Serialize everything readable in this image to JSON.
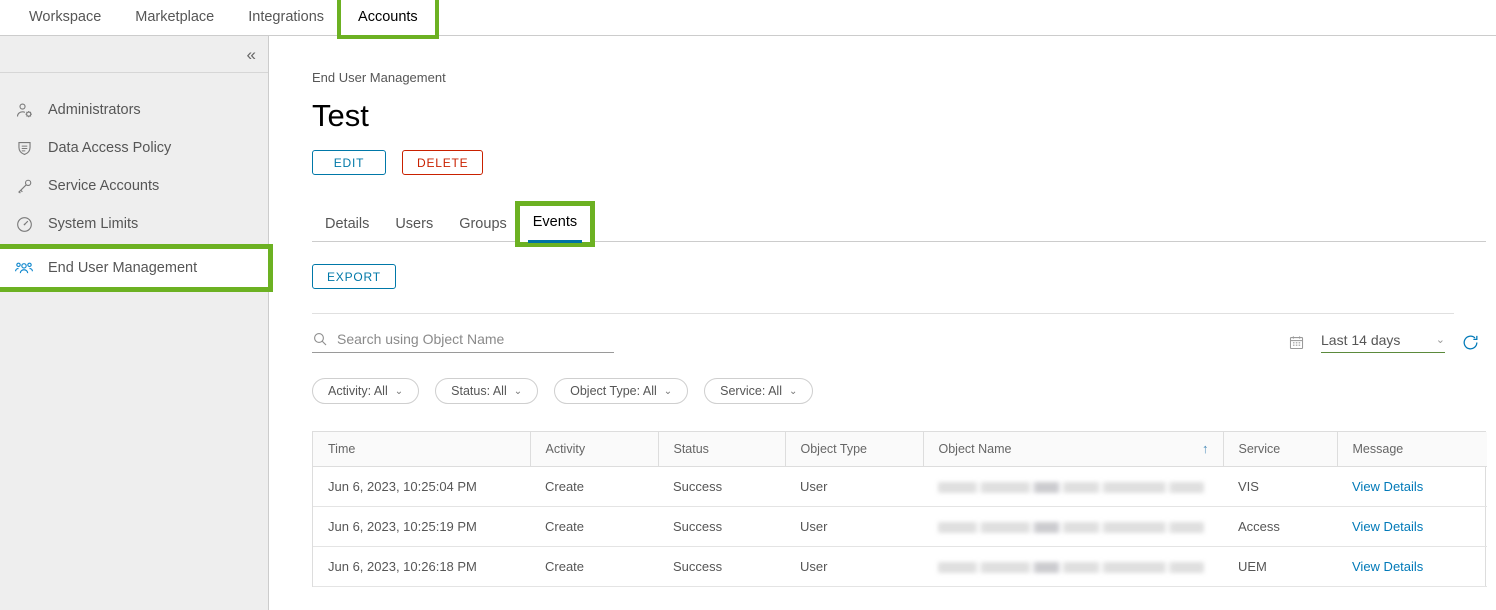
{
  "topnav": {
    "items": [
      {
        "label": "Workspace",
        "active": false,
        "highlighted": false
      },
      {
        "label": "Marketplace",
        "active": false,
        "highlighted": false
      },
      {
        "label": "Integrations",
        "active": false,
        "highlighted": false
      },
      {
        "label": "Accounts",
        "active": true,
        "highlighted": true
      }
    ]
  },
  "sidebar": {
    "collapse_icon": "«",
    "items": [
      {
        "label": "Administrators",
        "icon": "person-gear-icon",
        "active": false,
        "highlighted": false
      },
      {
        "label": "Data Access Policy",
        "icon": "policy-shield-icon",
        "active": false,
        "highlighted": false
      },
      {
        "label": "Service Accounts",
        "icon": "key-icon",
        "active": false,
        "highlighted": false
      },
      {
        "label": "System Limits",
        "icon": "gauge-icon",
        "active": false,
        "highlighted": false
      },
      {
        "label": "End User Management",
        "icon": "people-group-icon",
        "active": true,
        "highlighted": true
      }
    ]
  },
  "main": {
    "breadcrumb": "End User Management",
    "title": "Test",
    "edit_label": "EDIT",
    "delete_label": "DELETE",
    "export_label": "EXPORT",
    "tabs": [
      {
        "label": "Details",
        "active": false,
        "highlighted": false
      },
      {
        "label": "Users",
        "active": false,
        "highlighted": false
      },
      {
        "label": "Groups",
        "active": false,
        "highlighted": false
      },
      {
        "label": "Events",
        "active": true,
        "highlighted": true
      }
    ],
    "search": {
      "placeholder": "Search using Object Name",
      "value": "",
      "icon": "search-icon"
    },
    "daterange": {
      "calendar_icon": "calendar-icon",
      "value": "Last 14 days",
      "chevron": "⌄",
      "refresh_icon": "refresh-icon"
    },
    "filters": [
      {
        "label": "Activity: All",
        "chevron": "⌄"
      },
      {
        "label": "Status: All",
        "chevron": "⌄"
      },
      {
        "label": "Object Type: All",
        "chevron": "⌄"
      },
      {
        "label": "Service: All",
        "chevron": "⌄"
      }
    ],
    "table": {
      "columns": [
        "Time",
        "Activity",
        "Status",
        "Object Type",
        "Object Name",
        "Service",
        "Message"
      ],
      "sorted_column": "Object Name",
      "sort_direction": "↑",
      "rows": [
        {
          "time": "Jun 6, 2023, 10:25:04 PM",
          "activity": "Create",
          "status": "Success",
          "object_type": "User",
          "object_name": "",
          "object_name_redacted": true,
          "service": "VIS",
          "message": "View Details"
        },
        {
          "time": "Jun 6, 2023, 10:25:19 PM",
          "activity": "Create",
          "status": "Success",
          "object_type": "User",
          "object_name": "",
          "object_name_redacted": true,
          "service": "Access",
          "message": "View Details"
        },
        {
          "time": "Jun 6, 2023, 10:26:18 PM",
          "activity": "Create",
          "status": "Success",
          "object_type": "User",
          "object_name": "",
          "object_name_redacted": true,
          "service": "UEM",
          "message": "View Details"
        }
      ]
    }
  },
  "colors": {
    "highlight_green": "#6cb122",
    "link_blue": "#0079b8",
    "action_blue": "#0078a8",
    "danger_red": "#c92100",
    "tab_underline": "#0072a3",
    "sidebar_bg": "#eeeeee"
  }
}
